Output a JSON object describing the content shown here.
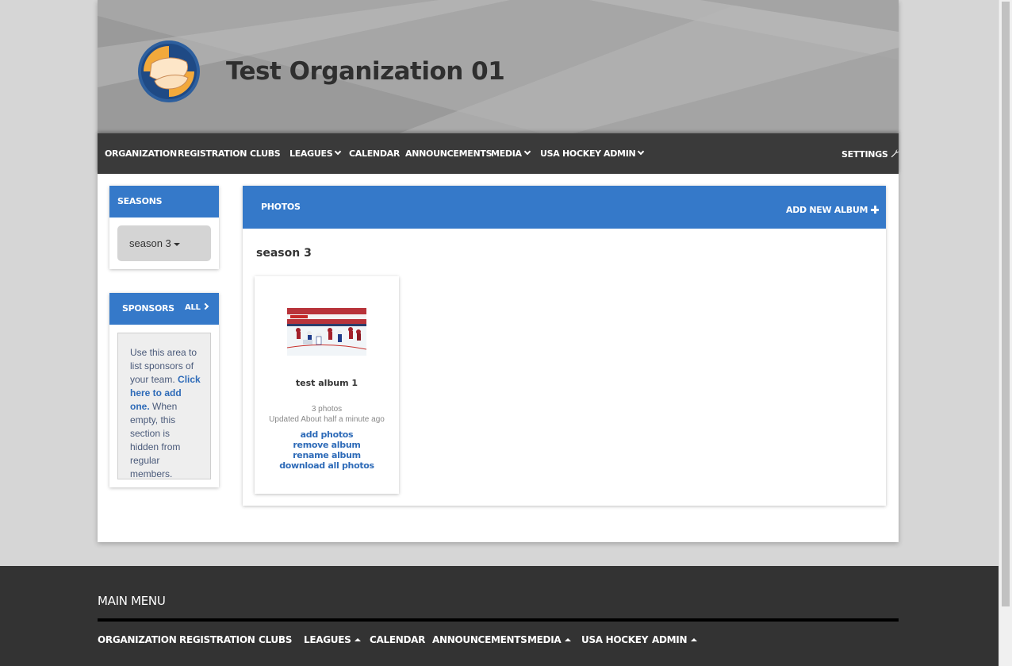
{
  "header": {
    "org_title": "Test Organization 01",
    "logo_icon": "hands-logo-icon"
  },
  "nav": {
    "items": [
      {
        "label": "ORGANIZATION"
      },
      {
        "label": "REGISTRATION"
      },
      {
        "label": "CLUBS"
      },
      {
        "label": "LEAGUES"
      },
      {
        "label": "CALENDAR"
      },
      {
        "label": "ANNOUNCEMENTS"
      },
      {
        "label": "MEDIA"
      },
      {
        "label": "USA HOCKEY"
      },
      {
        "label": "ADMIN"
      }
    ],
    "settings_label": "SETTINGS"
  },
  "seasons": {
    "title": "SEASONS",
    "selected": "season 3"
  },
  "sponsors": {
    "title": "SPONSORS",
    "all_label": "ALL",
    "text_before": "Use this area to list sponsors of your team. ",
    "link_text": "Click here to add one.",
    "text_after": " When empty, this section is hidden from regular members."
  },
  "photos": {
    "title": "PHOTOS",
    "add_album_label": "ADD NEW ALBUM",
    "season_heading": "season 3",
    "album": {
      "title": "test album 1",
      "count": "3 photos",
      "updated": "Updated About half a minute ago",
      "links": [
        "add photos",
        "remove album",
        "rename album",
        "download all photos"
      ]
    }
  },
  "footer": {
    "title": "MAIN MENU",
    "items": [
      {
        "label": "ORGANIZATION"
      },
      {
        "label": "REGISTRATION"
      },
      {
        "label": "CLUBS"
      },
      {
        "label": "LEAGUES"
      },
      {
        "label": "CALENDAR"
      },
      {
        "label": "ANNOUNCEMENTS"
      },
      {
        "label": "MEDIA"
      },
      {
        "label": "USA HOCKEY"
      },
      {
        "label": "ADMIN"
      }
    ]
  },
  "colors": {
    "accent_blue": "#3579c9",
    "nav_bg": "#3a3a3a",
    "footer_bg": "#333333",
    "link_blue": "#2e6bb8"
  }
}
